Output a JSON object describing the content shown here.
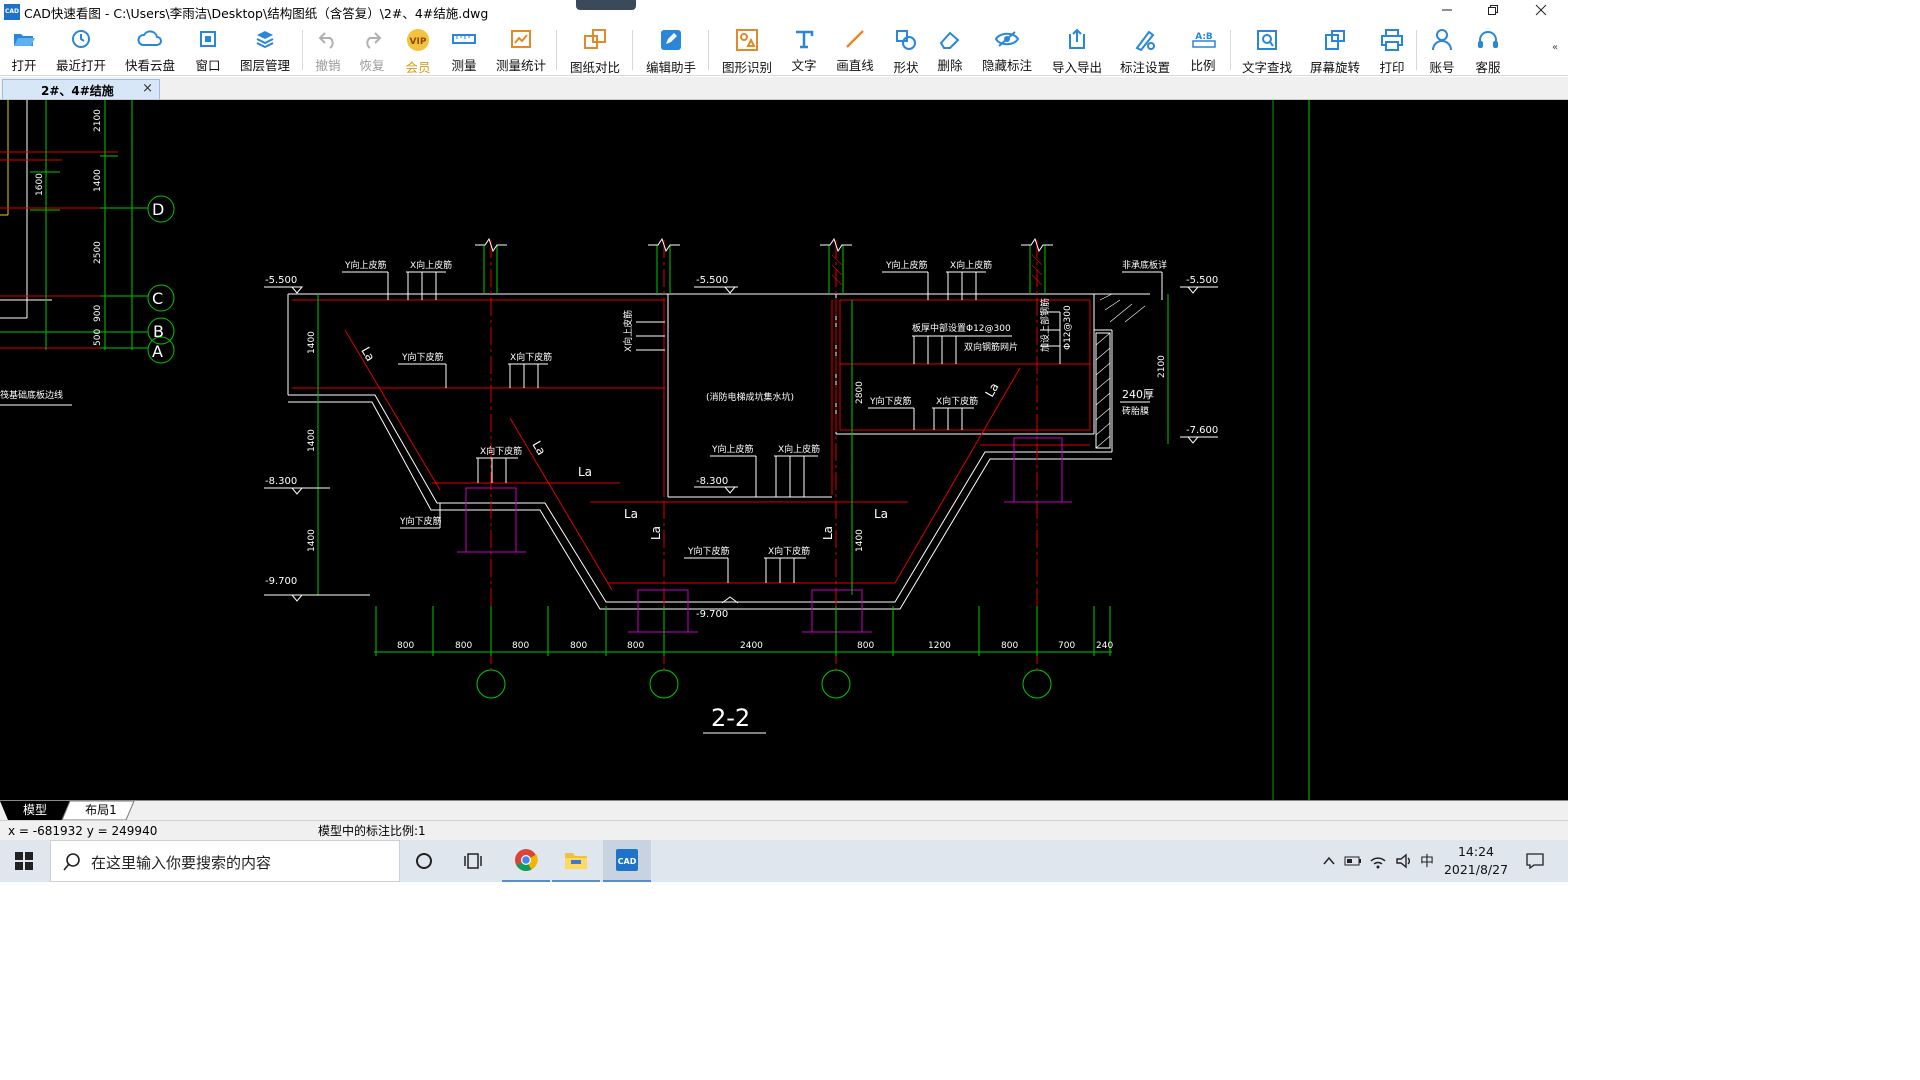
{
  "window": {
    "app_icon_text": "CAD",
    "title": "CAD快速看图 - C:\\Users\\李雨洁\\Desktop\\结构图纸（含答复）\\2#、4#结施.dwg"
  },
  "toolbar": {
    "items": [
      {
        "label": "打开",
        "icon": "folder-open-icon"
      },
      {
        "label": "最近打开",
        "icon": "clock-history-icon"
      },
      {
        "label": "快看云盘",
        "icon": "cloud-icon"
      },
      {
        "label": "窗口",
        "icon": "window-icon"
      },
      {
        "label": "图层管理",
        "icon": "layers-icon"
      },
      {
        "label": "撤销",
        "icon": "undo-icon",
        "disabled": true
      },
      {
        "label": "恢复",
        "icon": "redo-icon",
        "disabled": true
      },
      {
        "label": "会员",
        "icon": "vip-icon",
        "badge": "VIP"
      },
      {
        "label": "测量",
        "icon": "ruler-icon"
      },
      {
        "label": "测量统计",
        "icon": "measure-stats-icon"
      },
      {
        "label": "图纸对比",
        "icon": "compare-icon"
      },
      {
        "label": "编辑助手",
        "icon": "edit-assistant-icon"
      },
      {
        "label": "图形识别",
        "icon": "shape-recognize-icon"
      },
      {
        "label": "文字",
        "icon": "text-icon"
      },
      {
        "label": "画直线",
        "icon": "line-icon"
      },
      {
        "label": "形状",
        "icon": "shapes-icon"
      },
      {
        "label": "删除",
        "icon": "eraser-icon"
      },
      {
        "label": "隐藏标注",
        "icon": "hide-eye-icon"
      },
      {
        "label": "导入导出",
        "icon": "import-export-icon"
      },
      {
        "label": "标注设置",
        "icon": "annotation-settings-icon"
      },
      {
        "label": "比例",
        "icon": "scale-icon",
        "badge": "A:B"
      },
      {
        "label": "文字查找",
        "icon": "text-search-icon"
      },
      {
        "label": "屏幕旋转",
        "icon": "rotate-screen-icon"
      },
      {
        "label": "打印",
        "icon": "printer-icon"
      },
      {
        "label": "账号",
        "icon": "user-icon"
      },
      {
        "label": "客服",
        "icon": "headset-icon"
      }
    ]
  },
  "document_tab": {
    "label": "2#、4#结施",
    "close": "×"
  },
  "drawing": {
    "title": "2-2",
    "elevations": [
      "-5.500",
      "-5.500",
      "-5.500",
      "-7.600",
      "-8.300",
      "-8.300",
      "-9.700",
      "-9.700"
    ],
    "left_dims": [
      "2100",
      "1400",
      "1600",
      "2500",
      "900",
      "500"
    ],
    "axes": [
      "D",
      "C",
      "B",
      "A"
    ],
    "side_dims": [
      "1400",
      "1400",
      "1400",
      "2800",
      "2100",
      "1400"
    ],
    "bottom_dims": [
      "800",
      "800",
      "800",
      "800",
      "800",
      "2400",
      "800",
      "1200",
      "800",
      "700",
      "240"
    ],
    "labels": {
      "y_top_1": "Y向上皮筋",
      "x_top_1": "X向上皮筋",
      "y_top_2": "Y向上皮筋",
      "x_top_2": "X向上皮筋",
      "y_bot_1": "Y向下皮筋",
      "x_bot_1": "X向下皮筋",
      "x_bot_2": "X向下皮筋",
      "y_bot_2": "Y向下皮筋",
      "x_top_wall": "X向上皮筋",
      "pit": "(消防电梯成坑集水坑)",
      "y_top_3": "Y向上皮筋",
      "x_top_3": "X向上皮筋",
      "y_bot_3": "Y向下皮筋",
      "x_bot_3": "X向下皮筋",
      "y_bot_4": "Y向下皮筋",
      "x_bot_4": "X向下皮筋",
      "y_bot_5": "Y向下皮筋",
      "mid_mesh": "板厚中部设置Φ12@300",
      "mesh2": "双向钢筋网片",
      "v_mesh_1": "加设上部钢筋",
      "v_mesh_2": "Φ12@300",
      "ref_note": "非承底板详",
      "wall": "240厚",
      "wall2": "砖胎膜",
      "boundary": "筏基础底板边线",
      "La": "La"
    }
  },
  "layout_tabs": [
    {
      "label": "模型",
      "active": true
    },
    {
      "label": "布局1",
      "active": false
    }
  ],
  "status": {
    "coords": "x = -681932 y = 249940",
    "scale_text": "模型中的标注比例:1"
  },
  "taskbar": {
    "search_placeholder": "在这里输入你要搜索的内容",
    "time": "14:24",
    "date": "2021/8/27",
    "ime": "中"
  },
  "colors": {
    "canvas": "#000000",
    "grid_green": "#00c800",
    "rebar_red": "#e00000",
    "struct_white": "#ffffff",
    "magenta": "#c800c8"
  }
}
